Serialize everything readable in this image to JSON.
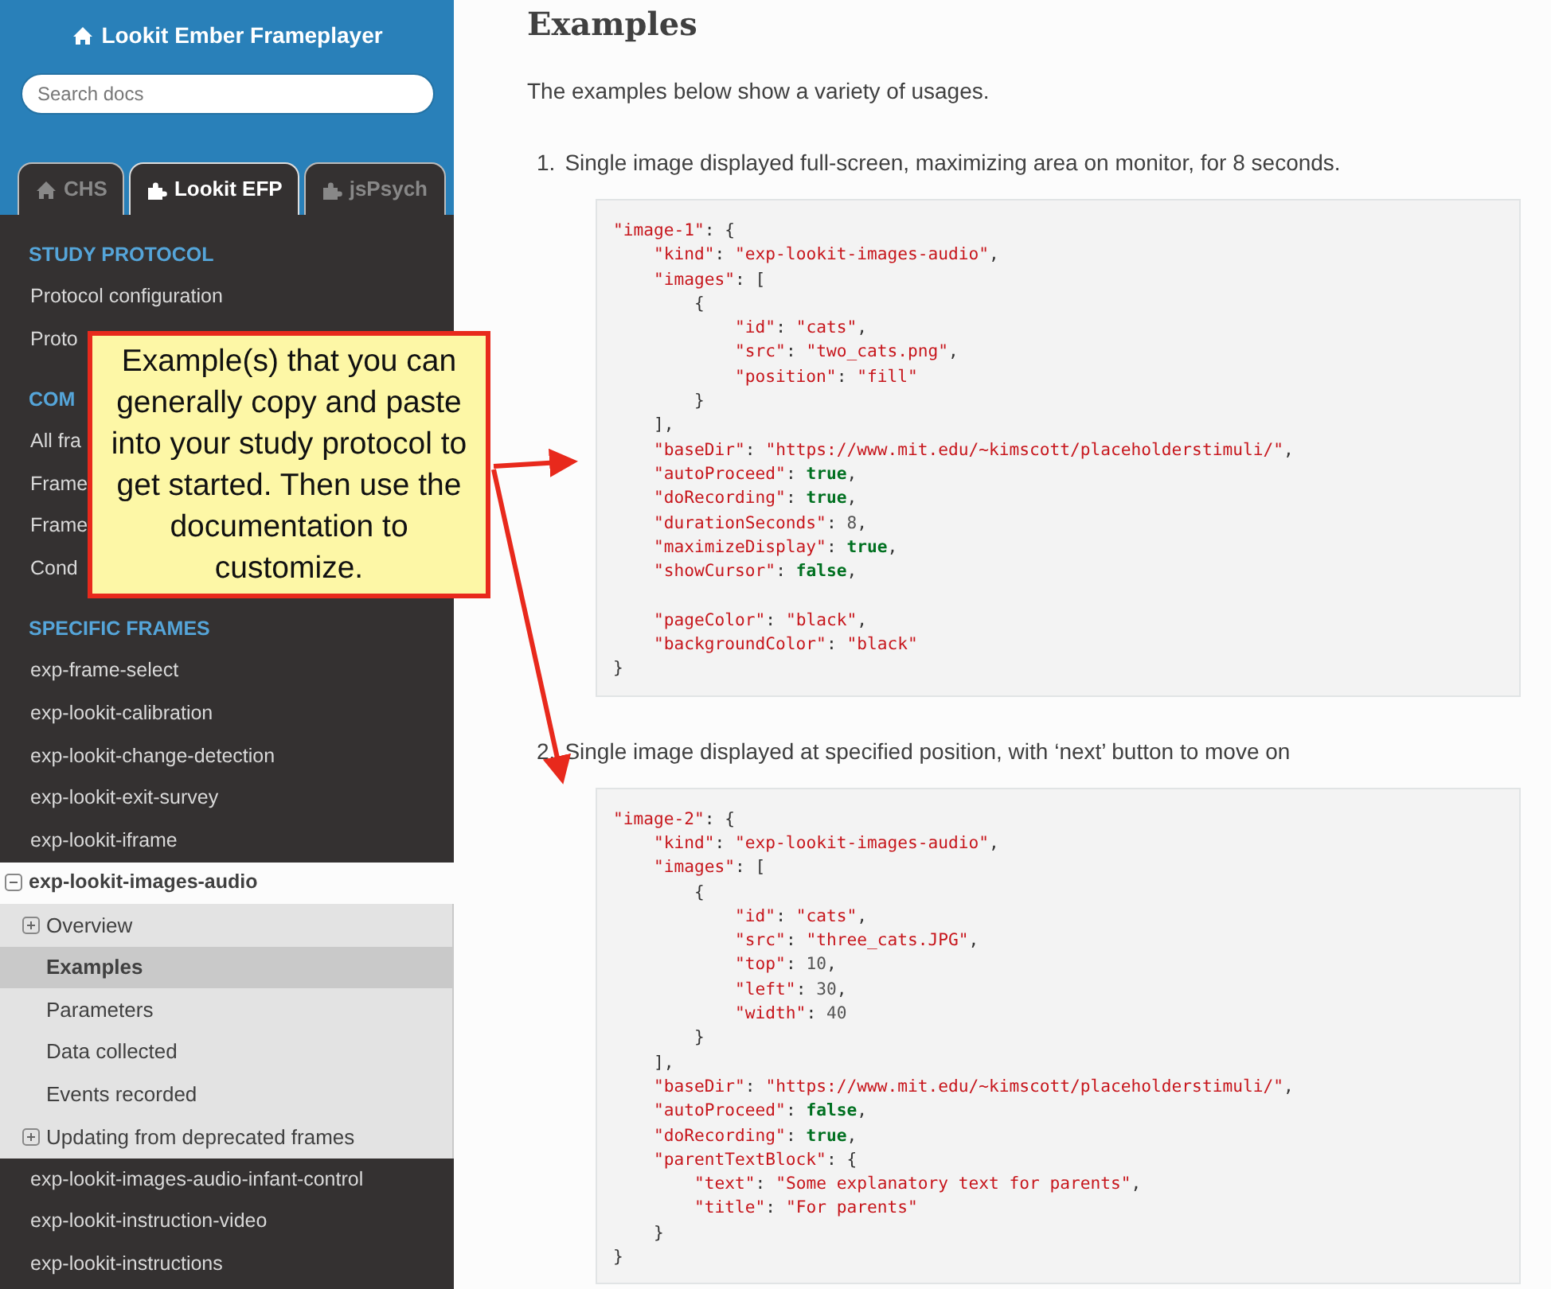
{
  "sidebar": {
    "title": "Lookit Ember Frameplayer",
    "search": {
      "placeholder": "Search docs"
    },
    "tabs": [
      {
        "label": "CHS",
        "selected": false
      },
      {
        "label": "Lookit EFP",
        "selected": true
      },
      {
        "label": "jsPsych",
        "selected": false
      }
    ],
    "sections": [
      {
        "caption": "STUDY PROTOCOL",
        "items": [
          {
            "label": "Protocol configuration"
          },
          {
            "label": "Proto"
          }
        ]
      },
      {
        "caption": "COM",
        "items": [
          {
            "label": "All fra"
          },
          {
            "label": "Frame"
          },
          {
            "label": "Frame"
          },
          {
            "label": "Cond"
          }
        ]
      },
      {
        "caption": "SPECIFIC FRAMES",
        "items": [
          {
            "label": "exp-frame-select"
          },
          {
            "label": "exp-lookit-calibration"
          },
          {
            "label": "exp-lookit-change-detection"
          },
          {
            "label": "exp-lookit-exit-survey"
          },
          {
            "label": "exp-lookit-iframe"
          },
          {
            "label": "exp-lookit-images-audio",
            "expanded": true,
            "children": [
              {
                "label": "Overview",
                "expandable": true,
                "selected": false
              },
              {
                "label": "Examples",
                "expandable": false,
                "selected": true
              },
              {
                "label": "Parameters",
                "expandable": false,
                "selected": false
              },
              {
                "label": "Data collected",
                "expandable": false,
                "selected": false
              },
              {
                "label": "Events recorded",
                "expandable": false,
                "selected": false
              },
              {
                "label": "Updating from deprecated frames",
                "expandable": true,
                "selected": false
              }
            ]
          },
          {
            "label": "exp-lookit-images-audio-infant-control"
          },
          {
            "label": "exp-lookit-instruction-video"
          },
          {
            "label": "exp-lookit-instructions"
          }
        ]
      }
    ]
  },
  "main": {
    "heading": "Examples",
    "intro": "The examples below show a variety of usages.",
    "examples": [
      {
        "number": "1.",
        "text": "Single image displayed full-screen, maximizing area on monitor, for 8 seconds.",
        "code": [
          [
            {
              "kind": "string",
              "text": "\"image-1\""
            },
            {
              "kind": "punct",
              "text": ": {"
            }
          ],
          [
            {
              "kind": "string",
              "text": "    \"kind\""
            },
            {
              "kind": "punct",
              "text": ": "
            },
            {
              "kind": "string",
              "text": "\"exp-lookit-images-audio\""
            },
            {
              "kind": "punct",
              "text": ","
            }
          ],
          [
            {
              "kind": "string",
              "text": "    \"images\""
            },
            {
              "kind": "punct",
              "text": ": ["
            }
          ],
          [
            {
              "kind": "punct",
              "text": "        {"
            }
          ],
          [
            {
              "kind": "string",
              "text": "            \"id\""
            },
            {
              "kind": "punct",
              "text": ": "
            },
            {
              "kind": "string",
              "text": "\"cats\""
            },
            {
              "kind": "punct",
              "text": ","
            }
          ],
          [
            {
              "kind": "string",
              "text": "            \"src\""
            },
            {
              "kind": "punct",
              "text": ": "
            },
            {
              "kind": "string",
              "text": "\"two_cats.png\""
            },
            {
              "kind": "punct",
              "text": ","
            }
          ],
          [
            {
              "kind": "string",
              "text": "            \"position\""
            },
            {
              "kind": "punct",
              "text": ": "
            },
            {
              "kind": "string",
              "text": "\"fill\""
            }
          ],
          [
            {
              "kind": "punct",
              "text": "        }"
            }
          ],
          [
            {
              "kind": "punct",
              "text": "    ],"
            }
          ],
          [
            {
              "kind": "string",
              "text": "    \"baseDir\""
            },
            {
              "kind": "punct",
              "text": ": "
            },
            {
              "kind": "string",
              "text": "\"https://www.mit.edu/~kimscott/placeholderstimuli/\""
            },
            {
              "kind": "punct",
              "text": ","
            }
          ],
          [
            {
              "kind": "string",
              "text": "    \"autoProceed\""
            },
            {
              "kind": "punct",
              "text": ": "
            },
            {
              "kind": "literal",
              "text": "true"
            },
            {
              "kind": "punct",
              "text": ","
            }
          ],
          [
            {
              "kind": "string",
              "text": "    \"doRecording\""
            },
            {
              "kind": "punct",
              "text": ": "
            },
            {
              "kind": "literal",
              "text": "true"
            },
            {
              "kind": "punct",
              "text": ","
            }
          ],
          [
            {
              "kind": "string",
              "text": "    \"durationSeconds\""
            },
            {
              "kind": "punct",
              "text": ": "
            },
            {
              "kind": "number",
              "text": "8"
            },
            {
              "kind": "punct",
              "text": ","
            }
          ],
          [
            {
              "kind": "string",
              "text": "    \"maximizeDisplay\""
            },
            {
              "kind": "punct",
              "text": ": "
            },
            {
              "kind": "literal",
              "text": "true"
            },
            {
              "kind": "punct",
              "text": ","
            }
          ],
          [
            {
              "kind": "string",
              "text": "    \"showCursor\""
            },
            {
              "kind": "punct",
              "text": ": "
            },
            {
              "kind": "literal",
              "text": "false"
            },
            {
              "kind": "punct",
              "text": ","
            }
          ],
          [
            {
              "kind": "blank"
            }
          ],
          [
            {
              "kind": "string",
              "text": "    \"pageColor\""
            },
            {
              "kind": "punct",
              "text": ": "
            },
            {
              "kind": "string",
              "text": "\"black\""
            },
            {
              "kind": "punct",
              "text": ","
            }
          ],
          [
            {
              "kind": "string",
              "text": "    \"backgroundColor\""
            },
            {
              "kind": "punct",
              "text": ": "
            },
            {
              "kind": "string",
              "text": "\"black\""
            }
          ],
          [
            {
              "kind": "punct",
              "text": "}"
            }
          ]
        ]
      },
      {
        "number": "2.",
        "text": "Single image displayed at specified position, with ‘next’ button to move on",
        "code": [
          [
            {
              "kind": "string",
              "text": "\"image-2\""
            },
            {
              "kind": "punct",
              "text": ": {"
            }
          ],
          [
            {
              "kind": "string",
              "text": "    \"kind\""
            },
            {
              "kind": "punct",
              "text": ": "
            },
            {
              "kind": "string",
              "text": "\"exp-lookit-images-audio\""
            },
            {
              "kind": "punct",
              "text": ","
            }
          ],
          [
            {
              "kind": "string",
              "text": "    \"images\""
            },
            {
              "kind": "punct",
              "text": ": ["
            }
          ],
          [
            {
              "kind": "punct",
              "text": "        {"
            }
          ],
          [
            {
              "kind": "string",
              "text": "            \"id\""
            },
            {
              "kind": "punct",
              "text": ": "
            },
            {
              "kind": "string",
              "text": "\"cats\""
            },
            {
              "kind": "punct",
              "text": ","
            }
          ],
          [
            {
              "kind": "string",
              "text": "            \"src\""
            },
            {
              "kind": "punct",
              "text": ": "
            },
            {
              "kind": "string",
              "text": "\"three_cats.JPG\""
            },
            {
              "kind": "punct",
              "text": ","
            }
          ],
          [
            {
              "kind": "string",
              "text": "            \"top\""
            },
            {
              "kind": "punct",
              "text": ": "
            },
            {
              "kind": "number",
              "text": "10"
            },
            {
              "kind": "punct",
              "text": ","
            }
          ],
          [
            {
              "kind": "string",
              "text": "            \"left\""
            },
            {
              "kind": "punct",
              "text": ": "
            },
            {
              "kind": "number",
              "text": "30"
            },
            {
              "kind": "punct",
              "text": ","
            }
          ],
          [
            {
              "kind": "string",
              "text": "            \"width\""
            },
            {
              "kind": "punct",
              "text": ": "
            },
            {
              "kind": "number",
              "text": "40"
            }
          ],
          [
            {
              "kind": "punct",
              "text": "        }"
            }
          ],
          [
            {
              "kind": "punct",
              "text": "    ],"
            }
          ],
          [
            {
              "kind": "string",
              "text": "    \"baseDir\""
            },
            {
              "kind": "punct",
              "text": ": "
            },
            {
              "kind": "string",
              "text": "\"https://www.mit.edu/~kimscott/placeholderstimuli/\""
            },
            {
              "kind": "punct",
              "text": ","
            }
          ],
          [
            {
              "kind": "string",
              "text": "    \"autoProceed\""
            },
            {
              "kind": "punct",
              "text": ": "
            },
            {
              "kind": "literal",
              "text": "false"
            },
            {
              "kind": "punct",
              "text": ","
            }
          ],
          [
            {
              "kind": "string",
              "text": "    \"doRecording\""
            },
            {
              "kind": "punct",
              "text": ": "
            },
            {
              "kind": "literal",
              "text": "true"
            },
            {
              "kind": "punct",
              "text": ","
            }
          ],
          [
            {
              "kind": "string",
              "text": "    \"parentTextBlock\""
            },
            {
              "kind": "punct",
              "text": ": {"
            }
          ],
          [
            {
              "kind": "string",
              "text": "        \"text\""
            },
            {
              "kind": "punct",
              "text": ": "
            },
            {
              "kind": "string",
              "text": "\"Some explanatory text for parents\""
            },
            {
              "kind": "punct",
              "text": ","
            }
          ],
          [
            {
              "kind": "string",
              "text": "        \"title\""
            },
            {
              "kind": "punct",
              "text": ": "
            },
            {
              "kind": "string",
              "text": "\"For parents\""
            }
          ],
          [
            {
              "kind": "punct",
              "text": "    }"
            }
          ],
          [
            {
              "kind": "punct",
              "text": "}"
            }
          ]
        ]
      }
    ]
  },
  "callout": {
    "text": "Example(s) that you can generally copy and paste into your study protocol to get started. Then use the documentation to customize."
  }
}
